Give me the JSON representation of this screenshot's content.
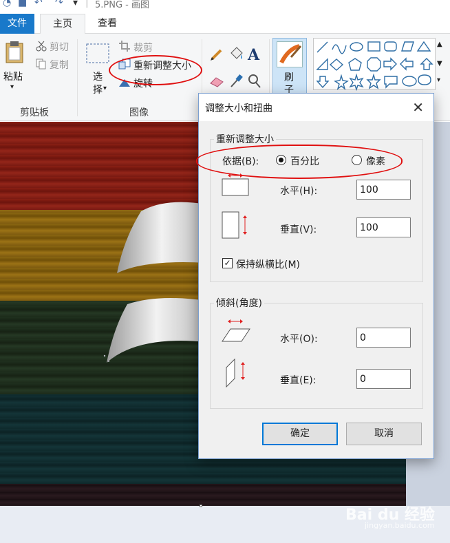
{
  "window": {
    "title": "5.PNG - 画图",
    "quick_access": [
      "save-icon",
      "undo-icon",
      "redo-icon",
      "customize-icon"
    ]
  },
  "tabs": [
    {
      "label": "文件"
    },
    {
      "label": "主页"
    },
    {
      "label": "查看"
    }
  ],
  "ribbon": {
    "clipboard": {
      "label": "剪贴板",
      "paste": "粘贴",
      "cut": "剪切",
      "copy": "复制"
    },
    "image": {
      "label": "图像",
      "select": "选\n择",
      "crop": "裁剪",
      "resize": "重新调整大小",
      "rotate": "旋转"
    },
    "tools": {
      "icons": [
        "pencil-icon",
        "fill-icon",
        "text-icon",
        "eraser-icon",
        "color-picker-icon",
        "magnifier-icon"
      ]
    },
    "brushes": {
      "label": "刷\n子"
    }
  },
  "dialog": {
    "title": "调整大小和扭曲",
    "resize": {
      "legend": "重新调整大小",
      "by_label": "依据(B):",
      "option_percent": "百分比",
      "option_pixels": "像素",
      "selected": "百分比",
      "horizontal_label": "水平(H):",
      "horizontal_value": "100",
      "vertical_label": "垂直(V):",
      "vertical_value": "100",
      "keep_ratio_label": "保持纵横比(M)",
      "keep_ratio_checked": true
    },
    "skew": {
      "legend": "倾斜(角度)",
      "horizontal_label": "水平(O):",
      "horizontal_value": "0",
      "vertical_label": "垂直(E):",
      "vertical_value": "0"
    },
    "ok": "确定",
    "cancel": "取消"
  },
  "watermark": {
    "brand": "Bai du 经验",
    "url": "jingyan.baidu.com"
  },
  "colors": {
    "accent": "#1979ca",
    "annotation": "#e01010",
    "ok_border": "#0078d7"
  }
}
